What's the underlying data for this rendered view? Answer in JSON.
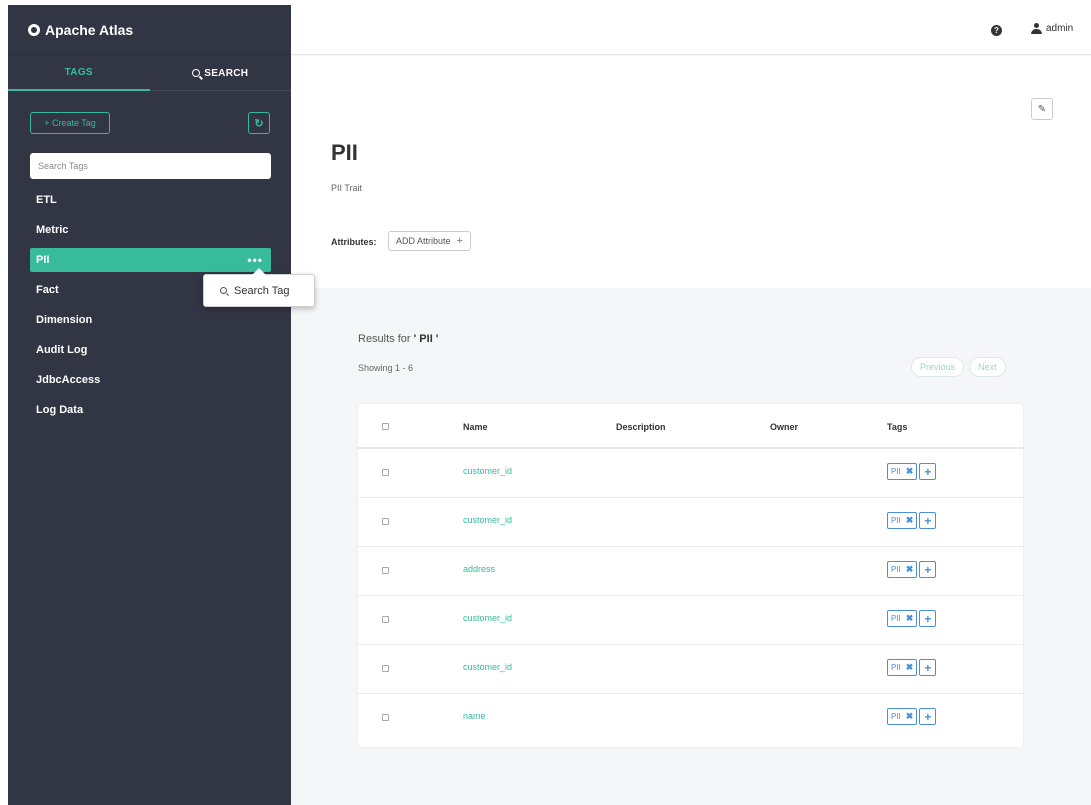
{
  "app": {
    "title": "Apache Atlas"
  },
  "sidebar": {
    "tabs": [
      {
        "label": "TAGS",
        "active": true
      },
      {
        "label": "SEARCH",
        "active": false
      }
    ],
    "create_tag_label": "+ Create Tag",
    "search_placeholder": "Search Tags",
    "tags": [
      {
        "label": "ETL"
      },
      {
        "label": "Metric"
      },
      {
        "label": "PII",
        "active": true
      },
      {
        "label": "Fact"
      },
      {
        "label": "Dimension"
      },
      {
        "label": "Audit Log"
      },
      {
        "label": "JdbcAccess"
      },
      {
        "label": "Log Data"
      }
    ],
    "popover_label": "Search Tag",
    "more_label": "•••"
  },
  "header": {
    "user": "admin",
    "help_icon": "question-circle-icon",
    "user_icon": "user-icon"
  },
  "detail": {
    "title": "PII",
    "description": "PII Trait",
    "attributes_label": "Attributes:",
    "add_attribute_label": "ADD Attribute",
    "edit_icon": "pencil-icon"
  },
  "results": {
    "prefix": "Results for",
    "query": " ' PII ' ",
    "showing": "Showing 1 - 6",
    "previous": "Previous",
    "next": "Next",
    "columns": [
      "Name",
      "Description",
      "Owner",
      "Tags"
    ],
    "rows": [
      {
        "name": "customer_id",
        "tag": "PII"
      },
      {
        "name": "customer_id",
        "tag": "PII"
      },
      {
        "name": "address",
        "tag": "PII"
      },
      {
        "name": "customer_id",
        "tag": "PII"
      },
      {
        "name": "customer_id",
        "tag": "PII"
      },
      {
        "name": "name",
        "tag": "PII"
      }
    ]
  },
  "colors": {
    "accent": "#37bb9b",
    "sidebar_bg": "#323544",
    "tag_chip": "#4a90d9"
  }
}
